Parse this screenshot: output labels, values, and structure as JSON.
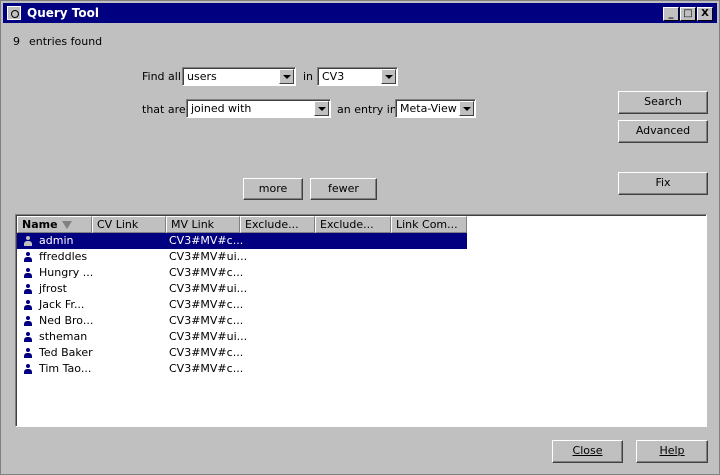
{
  "window": {
    "title": "Query Tool",
    "minimize": "_",
    "maximize": "□",
    "close": "X"
  },
  "status": {
    "count": "9",
    "text": "entries found"
  },
  "query": {
    "find_all_label": "Find all",
    "find_value": "users",
    "in_label": "in",
    "in_value": "CV3",
    "that_are_label": "that are",
    "relation_value": "joined with",
    "entry_in_label": "an entry in",
    "entry_value": "Meta-View"
  },
  "buttons": {
    "search": "Search",
    "advanced": "Advanced",
    "fix": "Fix",
    "more": "more",
    "fewer": "fewer",
    "close": "Close",
    "help": "Help"
  },
  "table": {
    "columns": [
      "Name",
      "CV Link",
      "MV Link",
      "Exclude...",
      "Exclude...",
      "Link Com..."
    ],
    "rows": [
      {
        "name": "admin",
        "cv_link": "",
        "mv_link": "CV3#MV#c..."
      },
      {
        "name": "ffreddles",
        "cv_link": "",
        "mv_link": "CV3#MV#ui..."
      },
      {
        "name": "Hungry ...",
        "cv_link": "",
        "mv_link": "CV3#MV#c..."
      },
      {
        "name": "jfrost",
        "cv_link": "",
        "mv_link": "CV3#MV#ui..."
      },
      {
        "name": "Jack Fr...",
        "cv_link": "",
        "mv_link": "CV3#MV#c..."
      },
      {
        "name": "Ned Bro...",
        "cv_link": "",
        "mv_link": "CV3#MV#c..."
      },
      {
        "name": "stheman",
        "cv_link": "",
        "mv_link": "CV3#MV#ui..."
      },
      {
        "name": "Ted Baker",
        "cv_link": "",
        "mv_link": "CV3#MV#c..."
      },
      {
        "name": "Tim Tao...",
        "cv_link": "",
        "mv_link": "CV3#MV#c..."
      }
    ]
  },
  "colors": {
    "face": "#c0c0c0",
    "title_bar": "#000080",
    "selection": "#000080"
  }
}
